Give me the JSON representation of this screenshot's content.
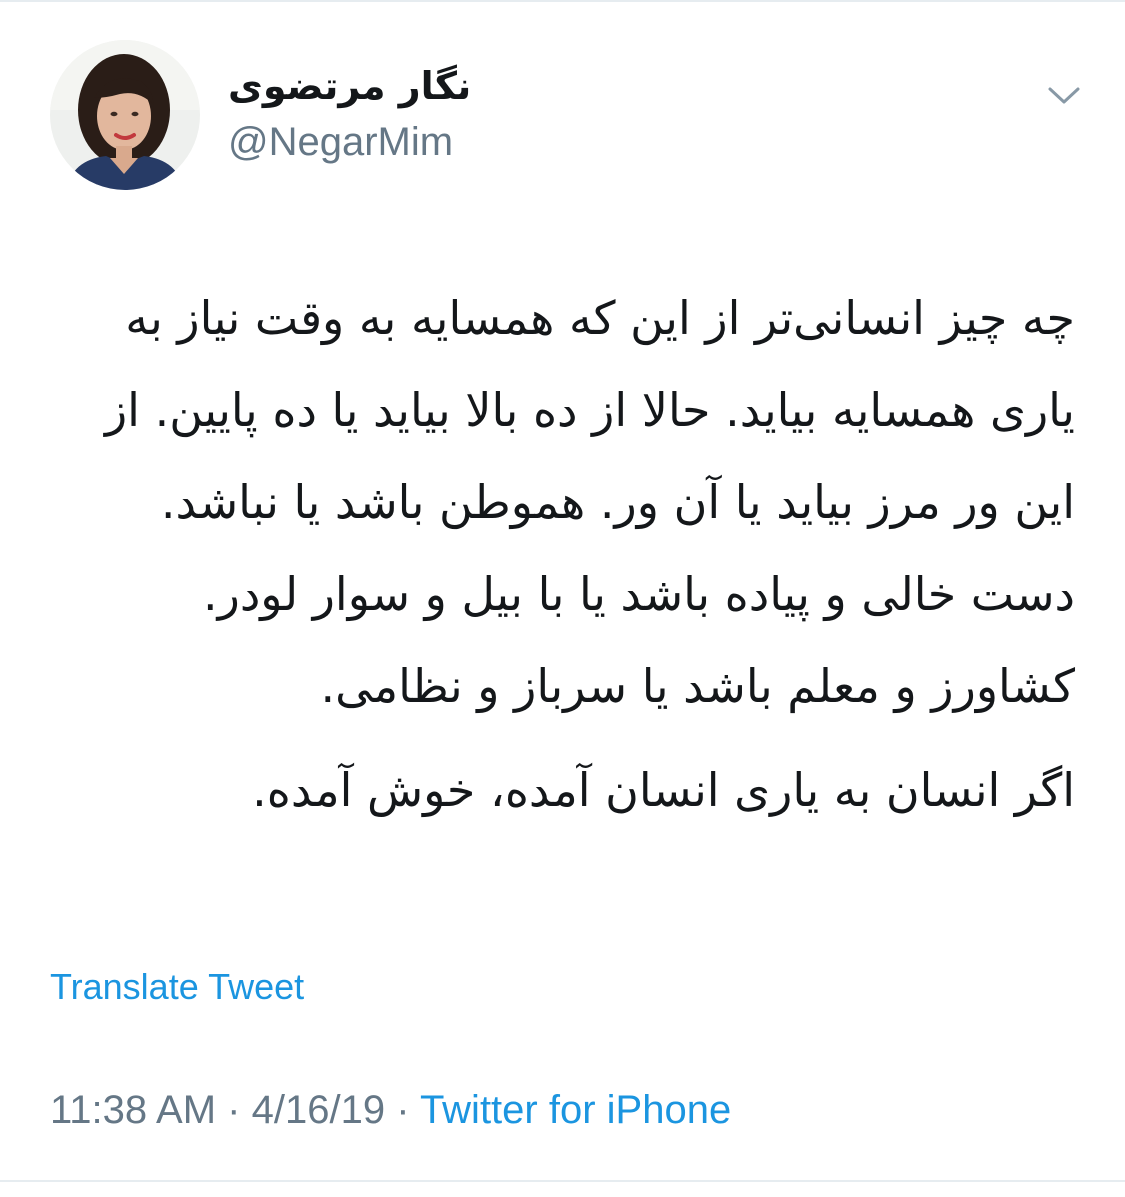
{
  "tweet": {
    "author": {
      "display_name": "نگار مرتضوی",
      "handle": "@NegarMim"
    },
    "menu_icon": "chevron-down-icon",
    "body_paragraphs": [
      "چه چیز انسانی‌تر از این که همسایه به وقت نیاز به یاری همسایه بیاید. حالا از ده بالا بیاید یا ده پایین. از این ور مرز بیاید یا آن ور. هموطن باشد یا نباشد. دست خالی و پیاده باشد یا با بیل و سوار لودر. کشاورز و معلم باشد یا سرباز و نظامی.",
      "اگر انسان به یاری انسان آمده، خوش آمده."
    ],
    "translate_label": "Translate Tweet",
    "timestamp_time": "11:38 AM",
    "separator": "·",
    "timestamp_date": "4/16/19",
    "source_label": "Twitter for iPhone"
  },
  "colors": {
    "text_primary": "#14171a",
    "text_secondary": "#657786",
    "link": "#1b95e0",
    "divider": "#e6ecf0"
  }
}
